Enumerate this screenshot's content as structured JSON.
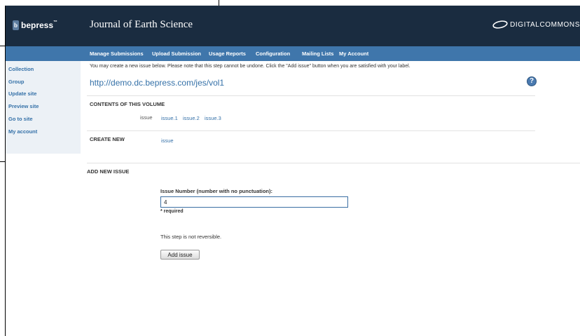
{
  "header": {
    "bepress_logo": "bepress",
    "journal_title": "Journal of Earth Science",
    "digital_commons_logo": "DIGITALCOMMONS"
  },
  "nav": {
    "items": [
      "Manage Submissions",
      "Upload Submission",
      "Usage Reports",
      "Configuration",
      "Mailing Lists",
      "My Account"
    ]
  },
  "sidebar": {
    "items": [
      "Collection",
      "Group",
      "Update site",
      "Preview site",
      "Go to site",
      "My account"
    ]
  },
  "main": {
    "instructions": "You may create a new issue below. Please note that this step cannot be undone. Click the \"Add issue\" button when you are satisfied with your label.",
    "volume_url": "http://demo.dc.bepress.com/jes/vol1",
    "help_icon": "?",
    "contents_heading": "CONTENTS OF THIS VOLUME",
    "contents_label": "issue",
    "issues": [
      "issue.1",
      "issue.2",
      "issue.3"
    ],
    "create_new_heading": "CREATE NEW",
    "create_new_link": "issue",
    "add_new_heading": "ADD NEW ISSUE",
    "issue_number_label": "Issue Number (number with no punctuation):",
    "issue_number_value": "4",
    "required_note": "* required",
    "not_reversible": "This step is not reversible.",
    "add_issue_button": "Add issue"
  },
  "colors": {
    "header_bg": "#1a2c40",
    "nav_bg": "#3f76ab",
    "sidebar_bg": "#ecf1f6",
    "link": "#3571a8"
  }
}
